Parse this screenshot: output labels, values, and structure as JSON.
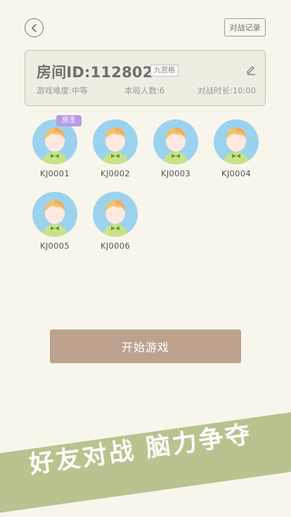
{
  "header": {
    "back_icon": "chevron-left-icon",
    "record_label": "对战记录"
  },
  "room": {
    "title": "房间ID:112802",
    "mode_tag": "九宫格",
    "edit_icon": "pencil-icon",
    "difficulty": "游戏难度:中等",
    "player_count": "本局人数:6",
    "duration": "对战时长:10:00"
  },
  "players": [
    {
      "name": "KJ0001",
      "badge": "房主"
    },
    {
      "name": "KJ0002"
    },
    {
      "name": "KJ0003"
    },
    {
      "name": "KJ0004"
    },
    {
      "name": "KJ0005"
    },
    {
      "name": "KJ0006"
    }
  ],
  "start_label": "开始游戏",
  "banner_text": "好友对战 脑力争夺",
  "colors": {
    "background": "#f8f6ec",
    "avatar_bg": "#9bd3ee",
    "host_badge": "#b99be5",
    "start_button": "#bda38e",
    "banner": "#b9c38f"
  }
}
